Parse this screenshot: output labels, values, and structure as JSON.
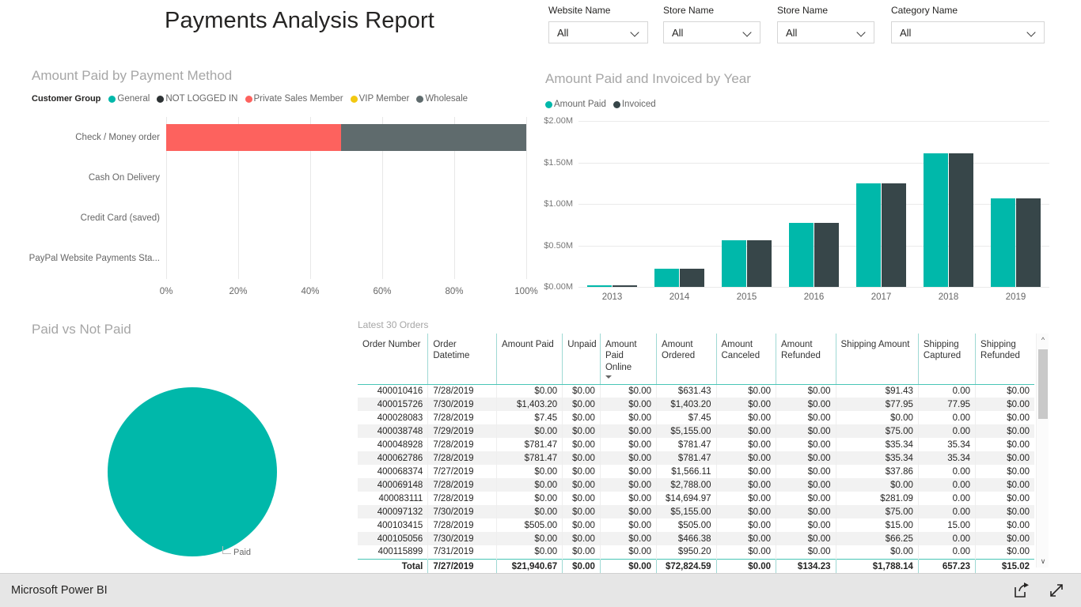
{
  "report": {
    "title": "Payments Analysis Report",
    "brand": "Microsoft Power BI"
  },
  "slicers": [
    {
      "label": "Website Name",
      "value": "All"
    },
    {
      "label": "Store Name",
      "value": "All"
    },
    {
      "label": "Store Name",
      "value": "All"
    },
    {
      "label": "Category Name",
      "value": "All"
    }
  ],
  "colors": {
    "general": "#00b8aa",
    "not_logged_in": "#2d3234",
    "private_sales_member": "#fd625e",
    "vip_member": "#f2c811",
    "wholesale": "#5f6b6d",
    "amount_paid": "#00b8aa",
    "invoiced": "#374649",
    "accent_border": "#49c5b6"
  },
  "bar_visual": {
    "title": "Amount Paid by Payment Method",
    "legend_title": "Customer Group",
    "legend": [
      {
        "label": "General",
        "color": "#00b8aa"
      },
      {
        "label": "NOT LOGGED IN",
        "color": "#2d3234"
      },
      {
        "label": "Private Sales Member",
        "color": "#fd625e"
      },
      {
        "label": "VIP Member",
        "color": "#f2c811"
      },
      {
        "label": "Wholesale",
        "color": "#5f6b6d"
      }
    ]
  },
  "column_visual": {
    "title": "Amount Paid and Invoiced by Year",
    "legend": [
      {
        "label": "Amount Paid",
        "color": "#00b8aa"
      },
      {
        "label": "Invoiced",
        "color": "#374649"
      }
    ]
  },
  "pie_visual": {
    "title": "Paid vs Not Paid",
    "callout_label": "Paid"
  },
  "table_visual": {
    "title": "Latest 30 Orders",
    "sorted_column": "Amount Paid Online",
    "columns": [
      "Order Number",
      "Order Datetime",
      "Amount Paid",
      "Unpaid",
      "Amount Paid Online",
      "Amount Ordered",
      "Amount Canceled",
      "Amount Refunded",
      "Shipping Amount",
      "Shipping Captured",
      "Shipping Refunded"
    ],
    "rows": [
      [
        "400010416",
        "7/28/2019",
        "$0.00",
        "$0.00",
        "$0.00",
        "$631.43",
        "$0.00",
        "$0.00",
        "$91.43",
        "0.00",
        "$0.00"
      ],
      [
        "400015726",
        "7/30/2019",
        "$1,403.20",
        "$0.00",
        "$0.00",
        "$1,403.20",
        "$0.00",
        "$0.00",
        "$77.95",
        "77.95",
        "$0.00"
      ],
      [
        "400028083",
        "7/28/2019",
        "$7.45",
        "$0.00",
        "$0.00",
        "$7.45",
        "$0.00",
        "$0.00",
        "$0.00",
        "0.00",
        "$0.00"
      ],
      [
        "400038748",
        "7/29/2019",
        "$0.00",
        "$0.00",
        "$0.00",
        "$5,155.00",
        "$0.00",
        "$0.00",
        "$75.00",
        "0.00",
        "$0.00"
      ],
      [
        "400048928",
        "7/28/2019",
        "$781.47",
        "$0.00",
        "$0.00",
        "$781.47",
        "$0.00",
        "$0.00",
        "$35.34",
        "35.34",
        "$0.00"
      ],
      [
        "400062786",
        "7/28/2019",
        "$781.47",
        "$0.00",
        "$0.00",
        "$781.47",
        "$0.00",
        "$0.00",
        "$35.34",
        "35.34",
        "$0.00"
      ],
      [
        "400068374",
        "7/27/2019",
        "$0.00",
        "$0.00",
        "$0.00",
        "$1,566.11",
        "$0.00",
        "$0.00",
        "$37.86",
        "0.00",
        "$0.00"
      ],
      [
        "400069148",
        "7/28/2019",
        "$0.00",
        "$0.00",
        "$0.00",
        "$2,788.00",
        "$0.00",
        "$0.00",
        "$0.00",
        "0.00",
        "$0.00"
      ],
      [
        "400083111",
        "7/28/2019",
        "$0.00",
        "$0.00",
        "$0.00",
        "$14,694.97",
        "$0.00",
        "$0.00",
        "$281.09",
        "0.00",
        "$0.00"
      ],
      [
        "400097132",
        "7/30/2019",
        "$0.00",
        "$0.00",
        "$0.00",
        "$5,155.00",
        "$0.00",
        "$0.00",
        "$75.00",
        "0.00",
        "$0.00"
      ],
      [
        "400103415",
        "7/28/2019",
        "$505.00",
        "$0.00",
        "$0.00",
        "$505.00",
        "$0.00",
        "$0.00",
        "$15.00",
        "15.00",
        "$0.00"
      ],
      [
        "400105056",
        "7/30/2019",
        "$0.00",
        "$0.00",
        "$0.00",
        "$466.38",
        "$0.00",
        "$0.00",
        "$66.25",
        "0.00",
        "$0.00"
      ],
      [
        "400115899",
        "7/31/2019",
        "$0.00",
        "$0.00",
        "$0.00",
        "$950.20",
        "$0.00",
        "$0.00",
        "$0.00",
        "0.00",
        "$0.00"
      ]
    ],
    "total_row": [
      "Total",
      "7/27/2019",
      "$21,940.67",
      "$0.00",
      "$0.00",
      "$72,824.59",
      "$0.00",
      "$134.23",
      "$1,788.14",
      "657.23",
      "$15.02"
    ]
  },
  "chart_data": [
    {
      "type": "bar",
      "orientation": "horizontal",
      "stacked": "100%",
      "title": "Amount Paid by Payment Method",
      "legend_title": "Customer Group",
      "categories": [
        "Check / Money order",
        "Cash On Delivery",
        "Credit Card (saved)",
        "PayPal Website Payments Sta..."
      ],
      "xlabel": "",
      "ylabel": "",
      "xlim": [
        0,
        100
      ],
      "xticks": [
        "0%",
        "20%",
        "40%",
        "60%",
        "80%",
        "100%"
      ],
      "grid": true,
      "legend_position": "top",
      "series": [
        {
          "name": "General",
          "color": "#00b8aa",
          "values": [
            0,
            0,
            0,
            0
          ]
        },
        {
          "name": "NOT LOGGED IN",
          "color": "#2d3234",
          "values": [
            0,
            0,
            0,
            0
          ]
        },
        {
          "name": "Private Sales Member",
          "color": "#fd625e",
          "values": [
            48.5,
            0,
            0,
            0
          ]
        },
        {
          "name": "VIP Member",
          "color": "#f2c811",
          "values": [
            0,
            0,
            0,
            0
          ]
        },
        {
          "name": "Wholesale",
          "color": "#5f6b6d",
          "values": [
            51.5,
            0,
            0,
            0
          ]
        }
      ]
    },
    {
      "type": "bar",
      "orientation": "vertical",
      "title": "Amount Paid and Invoiced by Year",
      "categories": [
        "2013",
        "2014",
        "2015",
        "2016",
        "2017",
        "2018",
        "2019"
      ],
      "xlabel": "",
      "ylabel": "",
      "ylim": [
        0,
        2000000
      ],
      "yticks": [
        "$0.00M",
        "$0.50M",
        "$1.00M",
        "$1.50M",
        "$2.00M"
      ],
      "grid": true,
      "legend_position": "top",
      "series": [
        {
          "name": "Amount Paid",
          "color": "#00b8aa",
          "values": [
            20000,
            220000,
            565000,
            770000,
            1245000,
            1605000,
            1065000
          ]
        },
        {
          "name": "Invoiced",
          "color": "#374649",
          "values": [
            20000,
            220000,
            565000,
            770000,
            1245000,
            1605000,
            1065000
          ]
        }
      ]
    },
    {
      "type": "pie",
      "title": "Paid vs Not Paid",
      "labels": [
        "Paid"
      ],
      "values": [
        100
      ],
      "colors": [
        "#00b8aa"
      ],
      "legend_position": "none"
    }
  ]
}
